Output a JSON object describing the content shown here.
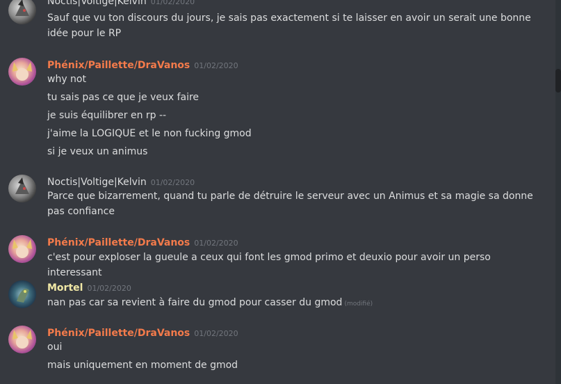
{
  "messages": [
    {
      "author": "Noctis|Voltige|Kelvin",
      "author_color": "#dcddde",
      "timestamp": "01/02/2020",
      "lines": [
        "Sauf que vu ton discours du jours, je sais pas exactement si te laisser en avoir un serait une bonne idée pour le RP"
      ]
    },
    {
      "author": "Phénix/Paillette/DraVanos",
      "author_color": "#f47b4b",
      "timestamp": "01/02/2020",
      "lines": [
        "why not",
        "tu sais pas ce que je veux faire",
        "je suis équilibrer en rp --",
        "j'aime la LOGIQUE et le non fucking gmod",
        "si je veux un animus"
      ]
    },
    {
      "author": "Noctis|Voltige|Kelvin",
      "author_color": "#dcddde",
      "timestamp": "01/02/2020",
      "lines": [
        "Parce que bizarrement, quand tu parle de détruire le serveur avec un Animus et sa magie sa donne pas confiance"
      ]
    },
    {
      "author": "Phénix/Paillette/DraVanos",
      "author_color": "#f47b4b",
      "timestamp": "01/02/2020",
      "lines": [
        "c'est pour exploser la gueule a ceux qui font les gmod primo et deuxio pour avoir un perso interessant"
      ]
    },
    {
      "author": "Mortel",
      "author_color": "#f1e8a6",
      "timestamp": "01/02/2020",
      "lines": [
        "nan pas car sa revient à faire du gmod pour casser du gmod"
      ],
      "edited_label": "(modifié)"
    },
    {
      "author": "Phénix/Paillette/DraVanos",
      "author_color": "#f47b4b",
      "timestamp": "01/02/2020",
      "lines": [
        "oui",
        "mais uniquement en moment de gmod"
      ]
    }
  ]
}
